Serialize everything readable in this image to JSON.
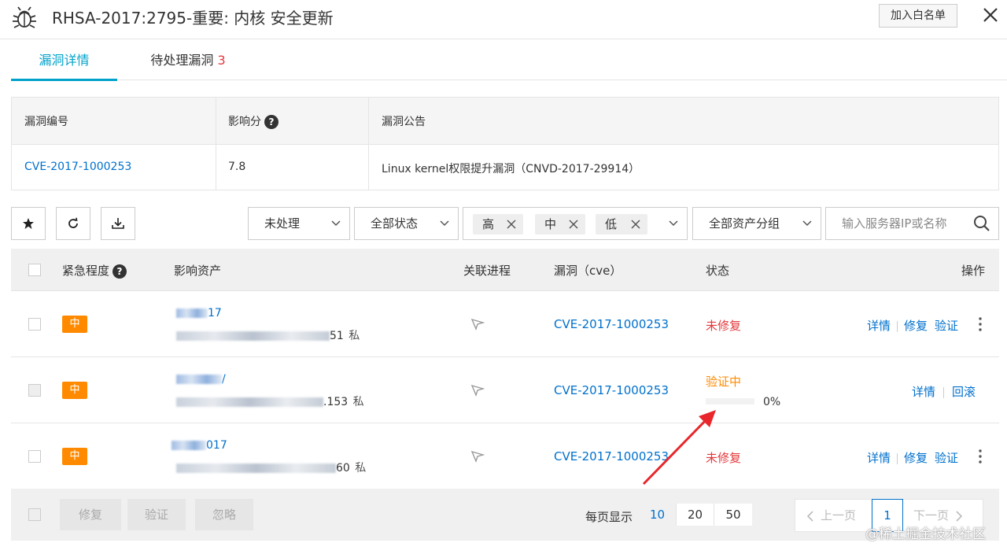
{
  "header": {
    "title": "RHSA-2017:2795-重要: 内核 安全更新",
    "whitelist_label": "加入白名单"
  },
  "tabs": {
    "details": "漏洞详情",
    "pending": "待处理漏洞",
    "pending_count": "3"
  },
  "info": {
    "headers": [
      "漏洞编号",
      "影响分",
      "漏洞公告"
    ],
    "help": "?",
    "cve_id": "CVE-2017-1000253",
    "score": "7.8",
    "bulletin": "Linux kernel权限提升漏洞（CNVD-2017-29914）"
  },
  "toolbar": {
    "icons": [
      "star-icon",
      "refresh-icon",
      "download-icon"
    ],
    "process_filter": "未处理",
    "status_filter": "全部状态",
    "level_tags": [
      "高",
      "中",
      "低"
    ],
    "asset_group_filter": "全部资产分组",
    "search_placeholder": "输入服务器IP或名称"
  },
  "table": {
    "headers": {
      "urgency": "紧急程度",
      "asset": "影响资产",
      "process": "关联进程",
      "cve": "漏洞（cve）",
      "status": "状态",
      "ops": "操作"
    },
    "rows": [
      {
        "urgency": "中",
        "asset_name_suffix": "17",
        "asset_ip_suffix": "51",
        "ip_tag": "私",
        "cve": "CVE-2017-1000253",
        "status": "未修复",
        "ops": [
          "详情",
          "修复",
          "验证"
        ]
      },
      {
        "urgency": "中",
        "asset_name_suffix": "/",
        "asset_ip_suffix": ".153",
        "ip_tag": "私",
        "cve": "CVE-2017-1000253",
        "status": "验证中",
        "progress": 0,
        "progress_text": "0%",
        "ops": [
          "详情",
          "回滚"
        ]
      },
      {
        "urgency": "中",
        "asset_name_suffix": "017",
        "asset_ip_suffix": "60",
        "ip_tag": "私",
        "cve": "CVE-2017-1000253",
        "status": "未修复",
        "ops": [
          "详情",
          "修复",
          "验证"
        ]
      }
    ]
  },
  "footer": {
    "actions": [
      "修复",
      "验证",
      "忽略"
    ],
    "per_page_label": "每页显示",
    "per_page_options": [
      "10",
      "20",
      "50"
    ],
    "per_page_selected": "10",
    "prev": "上一页",
    "current_page": "1",
    "next": "下一页"
  },
  "watermark": "@稀土掘金技术社区",
  "colors": {
    "accent": "#00a2ca",
    "link": "#0070cc",
    "danger": "#e4393c",
    "warning": "#ff8a00"
  }
}
